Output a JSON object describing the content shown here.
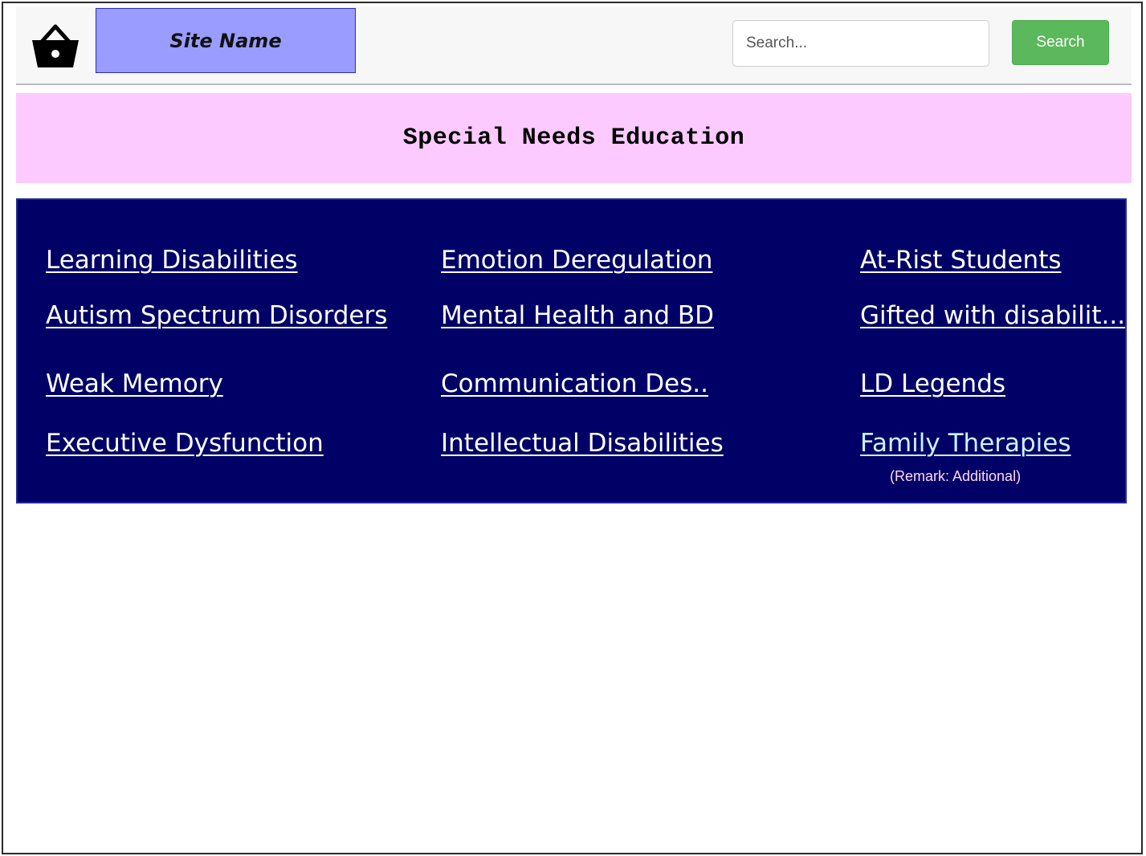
{
  "header": {
    "logo_text": "Site Name",
    "basket_icon": "shopping-basket-icon",
    "search_placeholder": "Search...",
    "search_button_label": "Search",
    "search_button_color": "#5cb85c",
    "logo_bg_color": "#9a9cff"
  },
  "banner": {
    "title": "Special Needs Education",
    "bg_color": "#fccaff"
  },
  "links_panel": {
    "bg_color": "#000066",
    "columns": [
      {
        "items": [
          {
            "label": "Learning Disabilities"
          },
          {
            "label": "Autism Spectrum Disorders"
          },
          {
            "label": "Weak Memory"
          },
          {
            "label": "Executive Dysfunction"
          }
        ]
      },
      {
        "items": [
          {
            "label": "Emotion Deregulation"
          },
          {
            "label": "Mental Health and BD"
          },
          {
            "label": "Communication Des.."
          },
          {
            "label": "Intellectual Disabilities"
          }
        ]
      },
      {
        "items": [
          {
            "label": "At-Rist Students"
          },
          {
            "label": "Gifted with disabilit..."
          },
          {
            "label": "LD Legends"
          },
          {
            "label": "Family Therapies"
          }
        ]
      }
    ],
    "remark": "(Remark: Additional)"
  }
}
